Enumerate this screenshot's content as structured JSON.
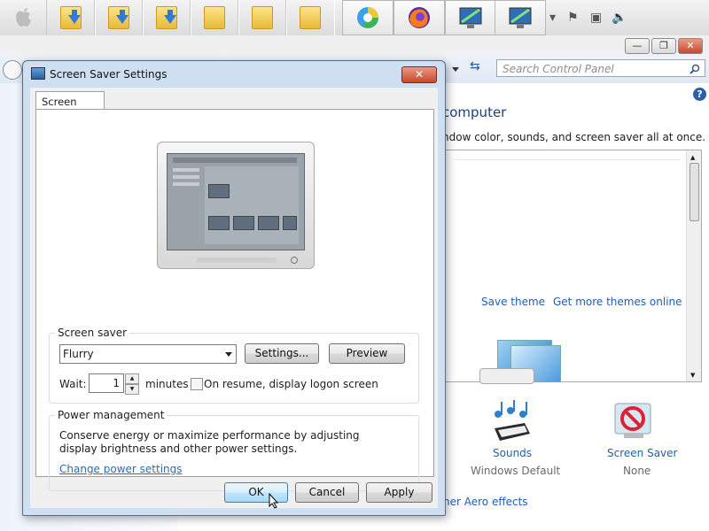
{
  "taskbar": {
    "items": [
      {
        "icon": "apple-icon"
      },
      {
        "icon": "folder-download-icon"
      },
      {
        "icon": "folder-download-icon"
      },
      {
        "icon": "folder-download-icon"
      },
      {
        "icon": "folder-icon"
      },
      {
        "icon": "folder-icon"
      },
      {
        "icon": "folder-icon"
      },
      {
        "icon": "browser-icon"
      },
      {
        "icon": "firefox-icon"
      },
      {
        "icon": "monitor-app-icon"
      },
      {
        "icon": "monitor-app-icon"
      }
    ],
    "tray": {
      "chevron": "▾",
      "flag": "⚑",
      "network": "▣",
      "volume": "🔈"
    }
  },
  "control_panel": {
    "search_placeholder": "Search Control Panel",
    "heading": "computer",
    "subtext": "ndow color, sounds, and screen saver all at once.",
    "save_theme": "Save theme",
    "more_themes": "Get more themes online",
    "sounds_label": "Sounds",
    "sounds_value": "Windows Default",
    "screensaver_label": "Screen Saver",
    "screensaver_value": "None",
    "aero_link": "her Aero effects"
  },
  "dialog": {
    "title": "Screen Saver Settings",
    "close": "✕",
    "tab": "Screen Saver",
    "screensaver_group": "Screen saver",
    "selected_saver": "Flurry",
    "settings_button": "Settings...",
    "preview_button": "Preview",
    "wait_label": "Wait:",
    "wait_value": "1",
    "minutes_label": "minutes",
    "resume_label": "On resume, display logon screen",
    "power_group": "Power management",
    "power_text": "Conserve energy or maximize performance by adjusting display brightness and other power settings.",
    "power_link": "Change power settings",
    "ok": "OK",
    "cancel": "Cancel",
    "apply": "Apply"
  }
}
